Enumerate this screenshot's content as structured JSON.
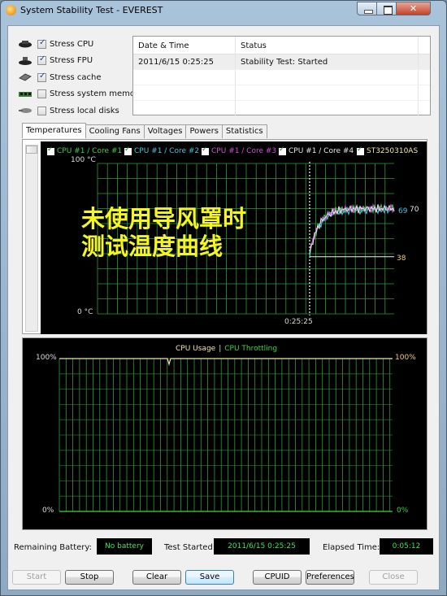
{
  "window": {
    "title": "System Stability Test - EVEREST",
    "close_glyph": "✕"
  },
  "stress_options": [
    {
      "label": "Stress CPU",
      "checked": true,
      "icon": "cpu-chip-icon"
    },
    {
      "label": "Stress FPU",
      "checked": true,
      "icon": "fpu-chip-icon"
    },
    {
      "label": "Stress cache",
      "checked": true,
      "icon": "cache-icon"
    },
    {
      "label": "Stress system memory",
      "checked": false,
      "icon": "memory-module-icon"
    },
    {
      "label": "Stress local disks",
      "checked": false,
      "icon": "disk-drive-icon"
    }
  ],
  "log": {
    "columns": [
      "Date & Time",
      "Status"
    ],
    "rows": [
      {
        "datetime": "2011/6/15 0:25:25",
        "status": "Stability Test: Started"
      }
    ]
  },
  "tabs": [
    {
      "label": "Temperatures",
      "active": true
    },
    {
      "label": "Cooling Fans",
      "active": false
    },
    {
      "label": "Voltages",
      "active": false
    },
    {
      "label": "Powers",
      "active": false
    },
    {
      "label": "Statistics",
      "active": false
    }
  ],
  "temperature_chart": {
    "y_max_label": "100 °C",
    "y_min_label": "0 °C",
    "x_marker_label": "0:25:25",
    "overlay_text_line1": "未使用导风罩时",
    "overlay_text_line2": "测试温度曲线",
    "overlay_color": "#f5f523",
    "grid_color": "#2e9a3c",
    "legend": [
      {
        "label": "CPU #1 / Core #1",
        "color": "#3fd14a",
        "checked": true
      },
      {
        "label": "CPU #1 / Core #2",
        "color": "#46c8d8",
        "checked": true
      },
      {
        "label": "CPU #1 / Core #3",
        "color": "#d34fd6",
        "checked": true
      },
      {
        "label": "CPU #1 / Core #4",
        "color": "#e8e8e8",
        "checked": true
      },
      {
        "label": "ST3250310AS",
        "color": "#f0e6a8",
        "checked": true
      }
    ],
    "end_labels": [
      {
        "text": "69",
        "color": "#46c8d8"
      },
      {
        "text": "70",
        "color": "#e8e8e8"
      },
      {
        "text": "38",
        "color": "#f0d070"
      }
    ]
  },
  "usage_chart": {
    "legend_cpu_usage": "CPU Usage",
    "legend_separator": "|",
    "legend_cpu_throttling": "CPU Throttling",
    "left_max_label": "100%",
    "left_min_label": "0%",
    "right_max_label": "100%",
    "right_min_label": "0%",
    "cpu_usage_percent": 100,
    "cpu_throttling_percent": 0
  },
  "chart_data": [
    {
      "type": "line",
      "title": "Temperatures",
      "ylabel": "°C",
      "ylim": [
        0,
        100
      ],
      "x_marker": "0:25:25",
      "series": [
        {
          "name": "CPU #1 / Core #1",
          "start": 40,
          "end": 70
        },
        {
          "name": "CPU #1 / Core #2",
          "start": 40,
          "end": 69
        },
        {
          "name": "CPU #1 / Core #3",
          "start": 40,
          "end": 70
        },
        {
          "name": "CPU #1 / Core #4",
          "start": 40,
          "end": 70
        },
        {
          "name": "ST3250310AS",
          "start": 38,
          "end": 38
        }
      ]
    },
    {
      "type": "line",
      "title": "CPU Usage | CPU Throttling",
      "ylim": [
        0,
        100
      ],
      "series": [
        {
          "name": "CPU Usage",
          "value": 100
        },
        {
          "name": "CPU Throttling",
          "value": 0
        }
      ]
    }
  ],
  "status_bar": {
    "battery_label": "Remaining Battery:",
    "battery_value": "No battery",
    "started_label": "Test Started:",
    "started_value": "2011/6/15 0:25:25",
    "elapsed_label": "Elapsed Time:",
    "elapsed_value": "0:05:12"
  },
  "buttons": {
    "start": "Start",
    "stop": "Stop",
    "clear": "Clear",
    "save": "Save",
    "cpuid": "CPUID",
    "preferences": "Preferences",
    "close": "Close"
  }
}
